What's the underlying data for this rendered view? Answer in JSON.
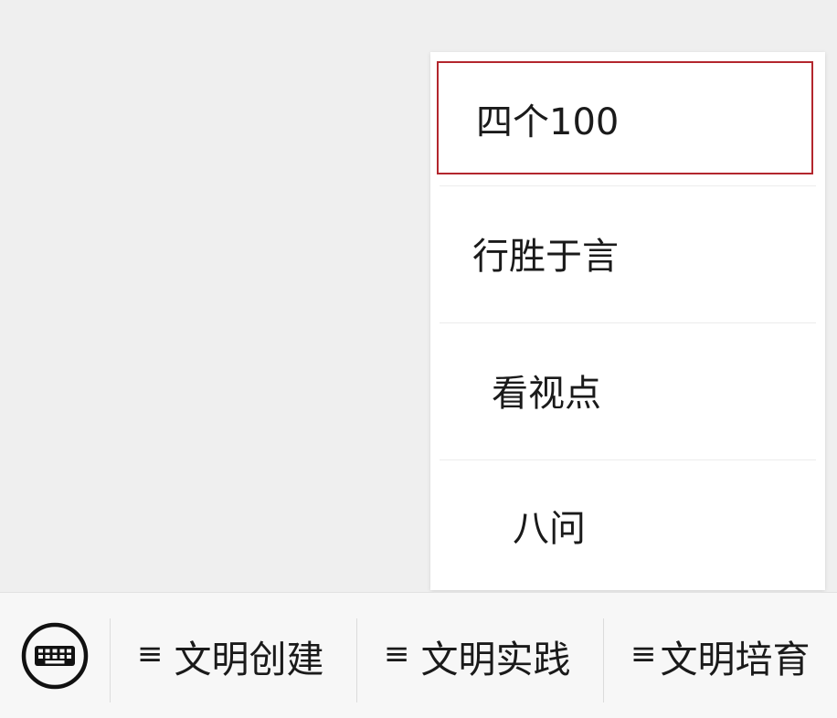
{
  "submenu": {
    "items": [
      {
        "label": "四个100",
        "selected": true
      },
      {
        "label": "行胜于言",
        "selected": false
      },
      {
        "label": "看视点",
        "selected": false
      },
      {
        "label": "八问",
        "selected": false
      }
    ]
  },
  "bottom_bar": {
    "keyboard_icon": "keyboard-icon",
    "menu_icon": "hamburger-icon",
    "hamburger_glyph": "≡",
    "tabs": [
      {
        "label": "文明创建"
      },
      {
        "label": "文明实践"
      },
      {
        "label": "文明培育"
      }
    ]
  },
  "colors": {
    "highlight_border": "#b3262d",
    "background": "#efefef",
    "menu_bg": "#ffffff"
  }
}
